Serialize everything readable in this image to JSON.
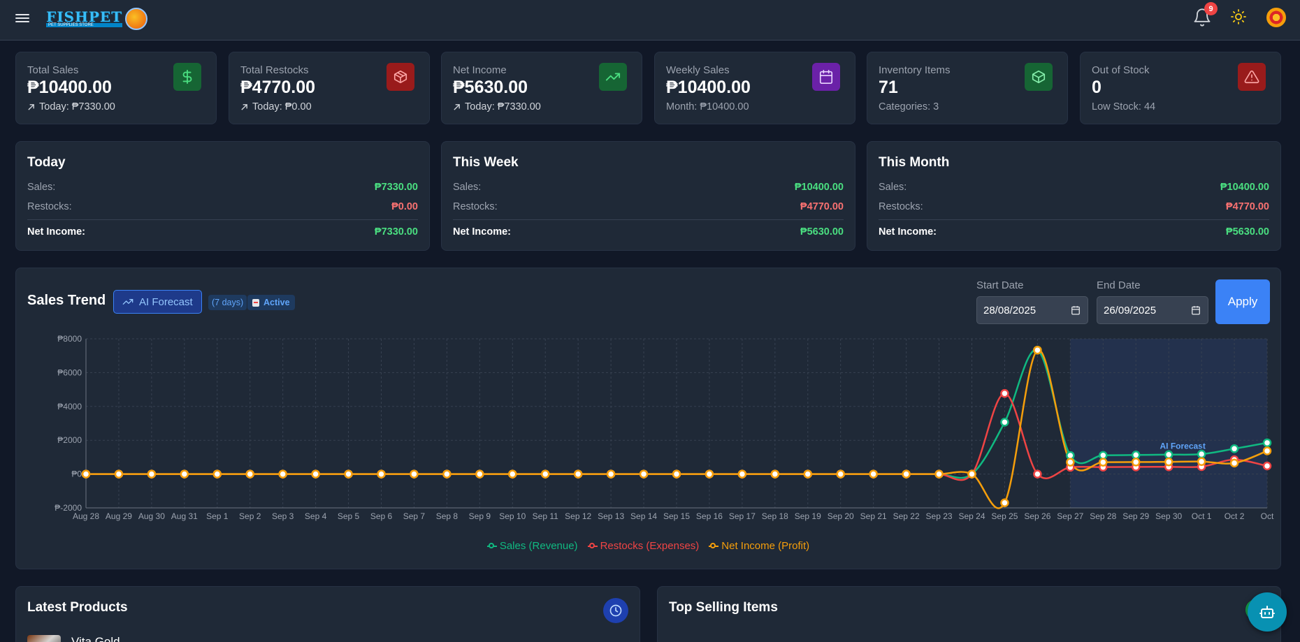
{
  "header": {
    "logo_text": "FISHPET",
    "logo_sub": "PET SUPPLIES STORE",
    "notifications_count": "9"
  },
  "stats": [
    {
      "label": "Total Sales",
      "value": "₱10400.00",
      "sub": "Today: ₱7330.00",
      "icon": "dollar-icon",
      "accent": "#22c55e"
    },
    {
      "label": "Total Restocks",
      "value": "₱4770.00",
      "sub": "Today: ₱0.00",
      "icon": "box-icon",
      "accent": "#ef4444"
    },
    {
      "label": "Net Income",
      "value": "₱5630.00",
      "sub": "Today: ₱7330.00",
      "icon": "trending-up-icon",
      "accent": "#22c55e"
    },
    {
      "label": "Weekly Sales",
      "value": "₱10400.00",
      "sub": "Month: ₱10400.00",
      "icon": "calendar-icon",
      "accent": "#a855f7"
    },
    {
      "label": "Inventory Items",
      "value": "71",
      "sub": "Categories: 3",
      "icon": "package-icon",
      "accent": "#22c55e"
    },
    {
      "label": "Out of Stock",
      "value": "0",
      "sub": "Low Stock: 44",
      "icon": "warning-icon",
      "accent": "#ef4444"
    }
  ],
  "periods": [
    {
      "title": "Today",
      "sales_label": "Sales:",
      "sales": "₱7330.00",
      "restocks_label": "Restocks:",
      "restocks": "₱0.00",
      "net_label": "Net Income:",
      "net": "₱7330.00"
    },
    {
      "title": "This Week",
      "sales_label": "Sales:",
      "sales": "₱10400.00",
      "restocks_label": "Restocks:",
      "restocks": "₱4770.00",
      "net_label": "Net Income:",
      "net": "₱5630.00"
    },
    {
      "title": "This Month",
      "sales_label": "Sales:",
      "sales": "₱10400.00",
      "restocks_label": "Restocks:",
      "restocks": "₱4770.00",
      "net_label": "Net Income:",
      "net": "₱5630.00"
    }
  ],
  "trend": {
    "title": "Sales Trend",
    "ai_button": "AI Forecast",
    "days_tag": "(7 days)",
    "active_tag": "Active",
    "start_label": "Start Date",
    "start_value": "28/08/2025",
    "end_label": "End Date",
    "end_value": "26/09/2025",
    "apply": "Apply",
    "forecast_label": "AI Forecast"
  },
  "chart_data": {
    "type": "line",
    "x": [
      "Aug 28",
      "Aug 29",
      "Aug 30",
      "Aug 31",
      "Sep 1",
      "Sep 2",
      "Sep 3",
      "Sep 4",
      "Sep 5",
      "Sep 6",
      "Sep 7",
      "Sep 8",
      "Sep 9",
      "Sep 10",
      "Sep 11",
      "Sep 12",
      "Sep 13",
      "Sep 14",
      "Sep 15",
      "Sep 16",
      "Sep 17",
      "Sep 18",
      "Sep 19",
      "Sep 20",
      "Sep 21",
      "Sep 22",
      "Sep 23",
      "Sep 24",
      "Sep 25",
      "Sep 26",
      "Sep 27",
      "Sep 28",
      "Sep 29",
      "Sep 30",
      "Oct 1",
      "Oct 2",
      "Oct"
    ],
    "y_ticks": [
      "₱8000",
      "₱6000",
      "₱4000",
      "₱2000",
      "₱0",
      "₱-2000"
    ],
    "ylim": [
      -2000,
      8000
    ],
    "forecast_start_index": 30,
    "series": [
      {
        "name": "Sales (Revenue)",
        "color": "#10b981",
        "values": [
          0,
          0,
          0,
          0,
          0,
          0,
          0,
          0,
          0,
          0,
          0,
          0,
          0,
          0,
          0,
          0,
          0,
          0,
          0,
          0,
          0,
          0,
          0,
          0,
          0,
          0,
          0,
          0,
          3070,
          7330,
          1100,
          1110,
          1130,
          1150,
          1180,
          1500,
          1850
        ]
      },
      {
        "name": "Restocks (Expenses)",
        "color": "#ef4444",
        "values": [
          0,
          0,
          0,
          0,
          0,
          0,
          0,
          0,
          0,
          0,
          0,
          0,
          0,
          0,
          0,
          0,
          0,
          0,
          0,
          0,
          0,
          0,
          0,
          0,
          0,
          0,
          0,
          0,
          4770,
          0,
          400,
          410,
          420,
          430,
          440,
          850,
          480
        ]
      },
      {
        "name": "Net Income (Profit)",
        "color": "#f59e0b",
        "values": [
          0,
          0,
          0,
          0,
          0,
          0,
          0,
          0,
          0,
          0,
          0,
          0,
          0,
          0,
          0,
          0,
          0,
          0,
          0,
          0,
          0,
          0,
          0,
          0,
          0,
          0,
          0,
          0,
          -1700,
          7330,
          700,
          700,
          710,
          720,
          740,
          650,
          1370
        ]
      }
    ]
  },
  "bottom": {
    "latest_title": "Latest Products",
    "latest_item": "Vita Gold",
    "top_title": "Top Selling Items"
  }
}
